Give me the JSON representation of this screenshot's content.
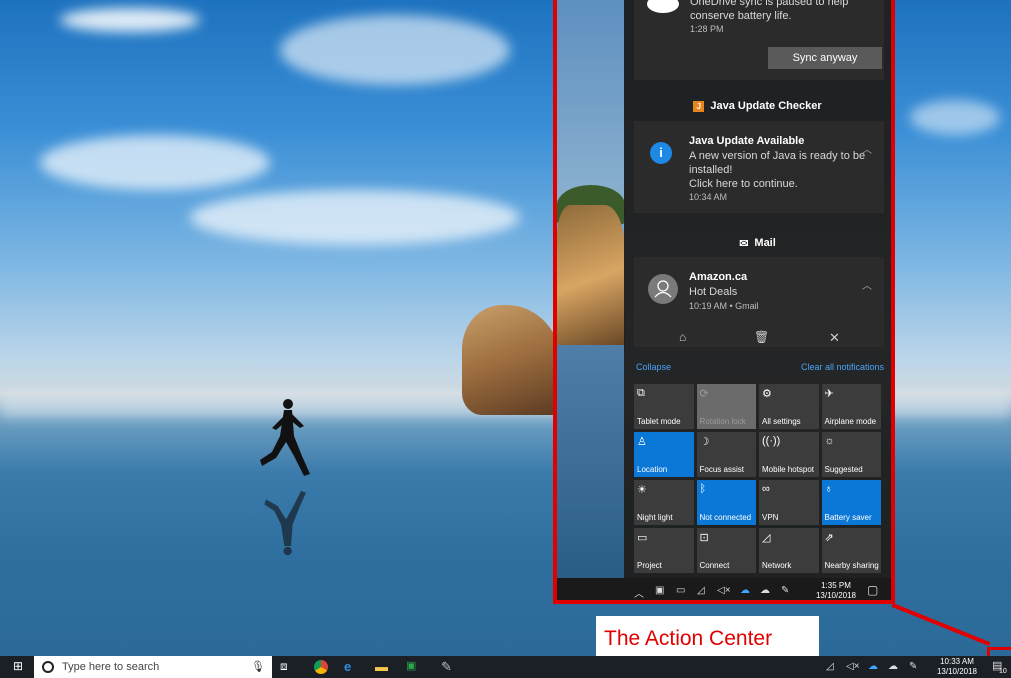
{
  "notifications": {
    "onedrive": {
      "text": "OneDrive sync is paused to help conserve battery life.",
      "time": "1:28 PM",
      "button": "Sync anyway"
    },
    "java_group": {
      "header": "Java Update Checker",
      "title": "Java Update Available",
      "body1": "A new version of Java is ready to be",
      "body2": "installed!",
      "body3": "Click here to continue.",
      "time": "10:34 AM"
    },
    "mail_group": {
      "header": "Mail",
      "sender": "Amazon.ca",
      "subject": "Hot Deals",
      "meta": "10:19 AM • Gmail"
    }
  },
  "links": {
    "collapse": "Collapse",
    "clear_all": "Clear all notifications"
  },
  "tiles": [
    {
      "label": "Tablet mode",
      "icon": "tablet-icon",
      "glyph": "⧉",
      "state": "off"
    },
    {
      "label": "Rotation lock",
      "icon": "rotation-lock-icon",
      "glyph": "⟳",
      "state": "disabled"
    },
    {
      "label": "All settings",
      "icon": "gear-icon",
      "glyph": "⚙",
      "state": "off"
    },
    {
      "label": "Airplane mode",
      "icon": "airplane-icon",
      "glyph": "✈",
      "state": "off"
    },
    {
      "label": "Location",
      "icon": "location-icon",
      "glyph": "♙",
      "state": "on"
    },
    {
      "label": "Focus assist",
      "icon": "moon-icon",
      "glyph": "☽",
      "state": "off"
    },
    {
      "label": "Mobile hotspot",
      "icon": "hotspot-icon",
      "glyph": "((·))",
      "state": "off"
    },
    {
      "label": "Suggested",
      "icon": "brightness-icon",
      "glyph": "☼",
      "state": "off"
    },
    {
      "label": "Night light",
      "icon": "night-light-icon",
      "glyph": "☀",
      "state": "off"
    },
    {
      "label": "Not connected",
      "icon": "bluetooth-icon",
      "glyph": "ᛒ",
      "state": "on"
    },
    {
      "label": "VPN",
      "icon": "vpn-icon",
      "glyph": "∞",
      "state": "off"
    },
    {
      "label": "Battery saver",
      "icon": "battery-saver-icon",
      "glyph": "♁",
      "state": "on"
    },
    {
      "label": "Project",
      "icon": "project-icon",
      "glyph": "▭",
      "state": "off"
    },
    {
      "label": "Connect",
      "icon": "connect-icon",
      "glyph": "⊡",
      "state": "off"
    },
    {
      "label": "Network",
      "icon": "network-icon",
      "glyph": "◿",
      "state": "off"
    },
    {
      "label": "Nearby sharing",
      "icon": "share-icon",
      "glyph": "⇗",
      "state": "off"
    }
  ],
  "mini_tray": {
    "time": "1:35 PM",
    "date": "13/10/2018"
  },
  "caption": "The Action Center",
  "taskbar": {
    "search_placeholder": "Type here to search",
    "time": "10:33 AM",
    "date": "13/10/2018",
    "badge": "10"
  },
  "colors": {
    "accent": "#0b78d7",
    "highlight": "#e00000",
    "link": "#4aa3f5"
  }
}
